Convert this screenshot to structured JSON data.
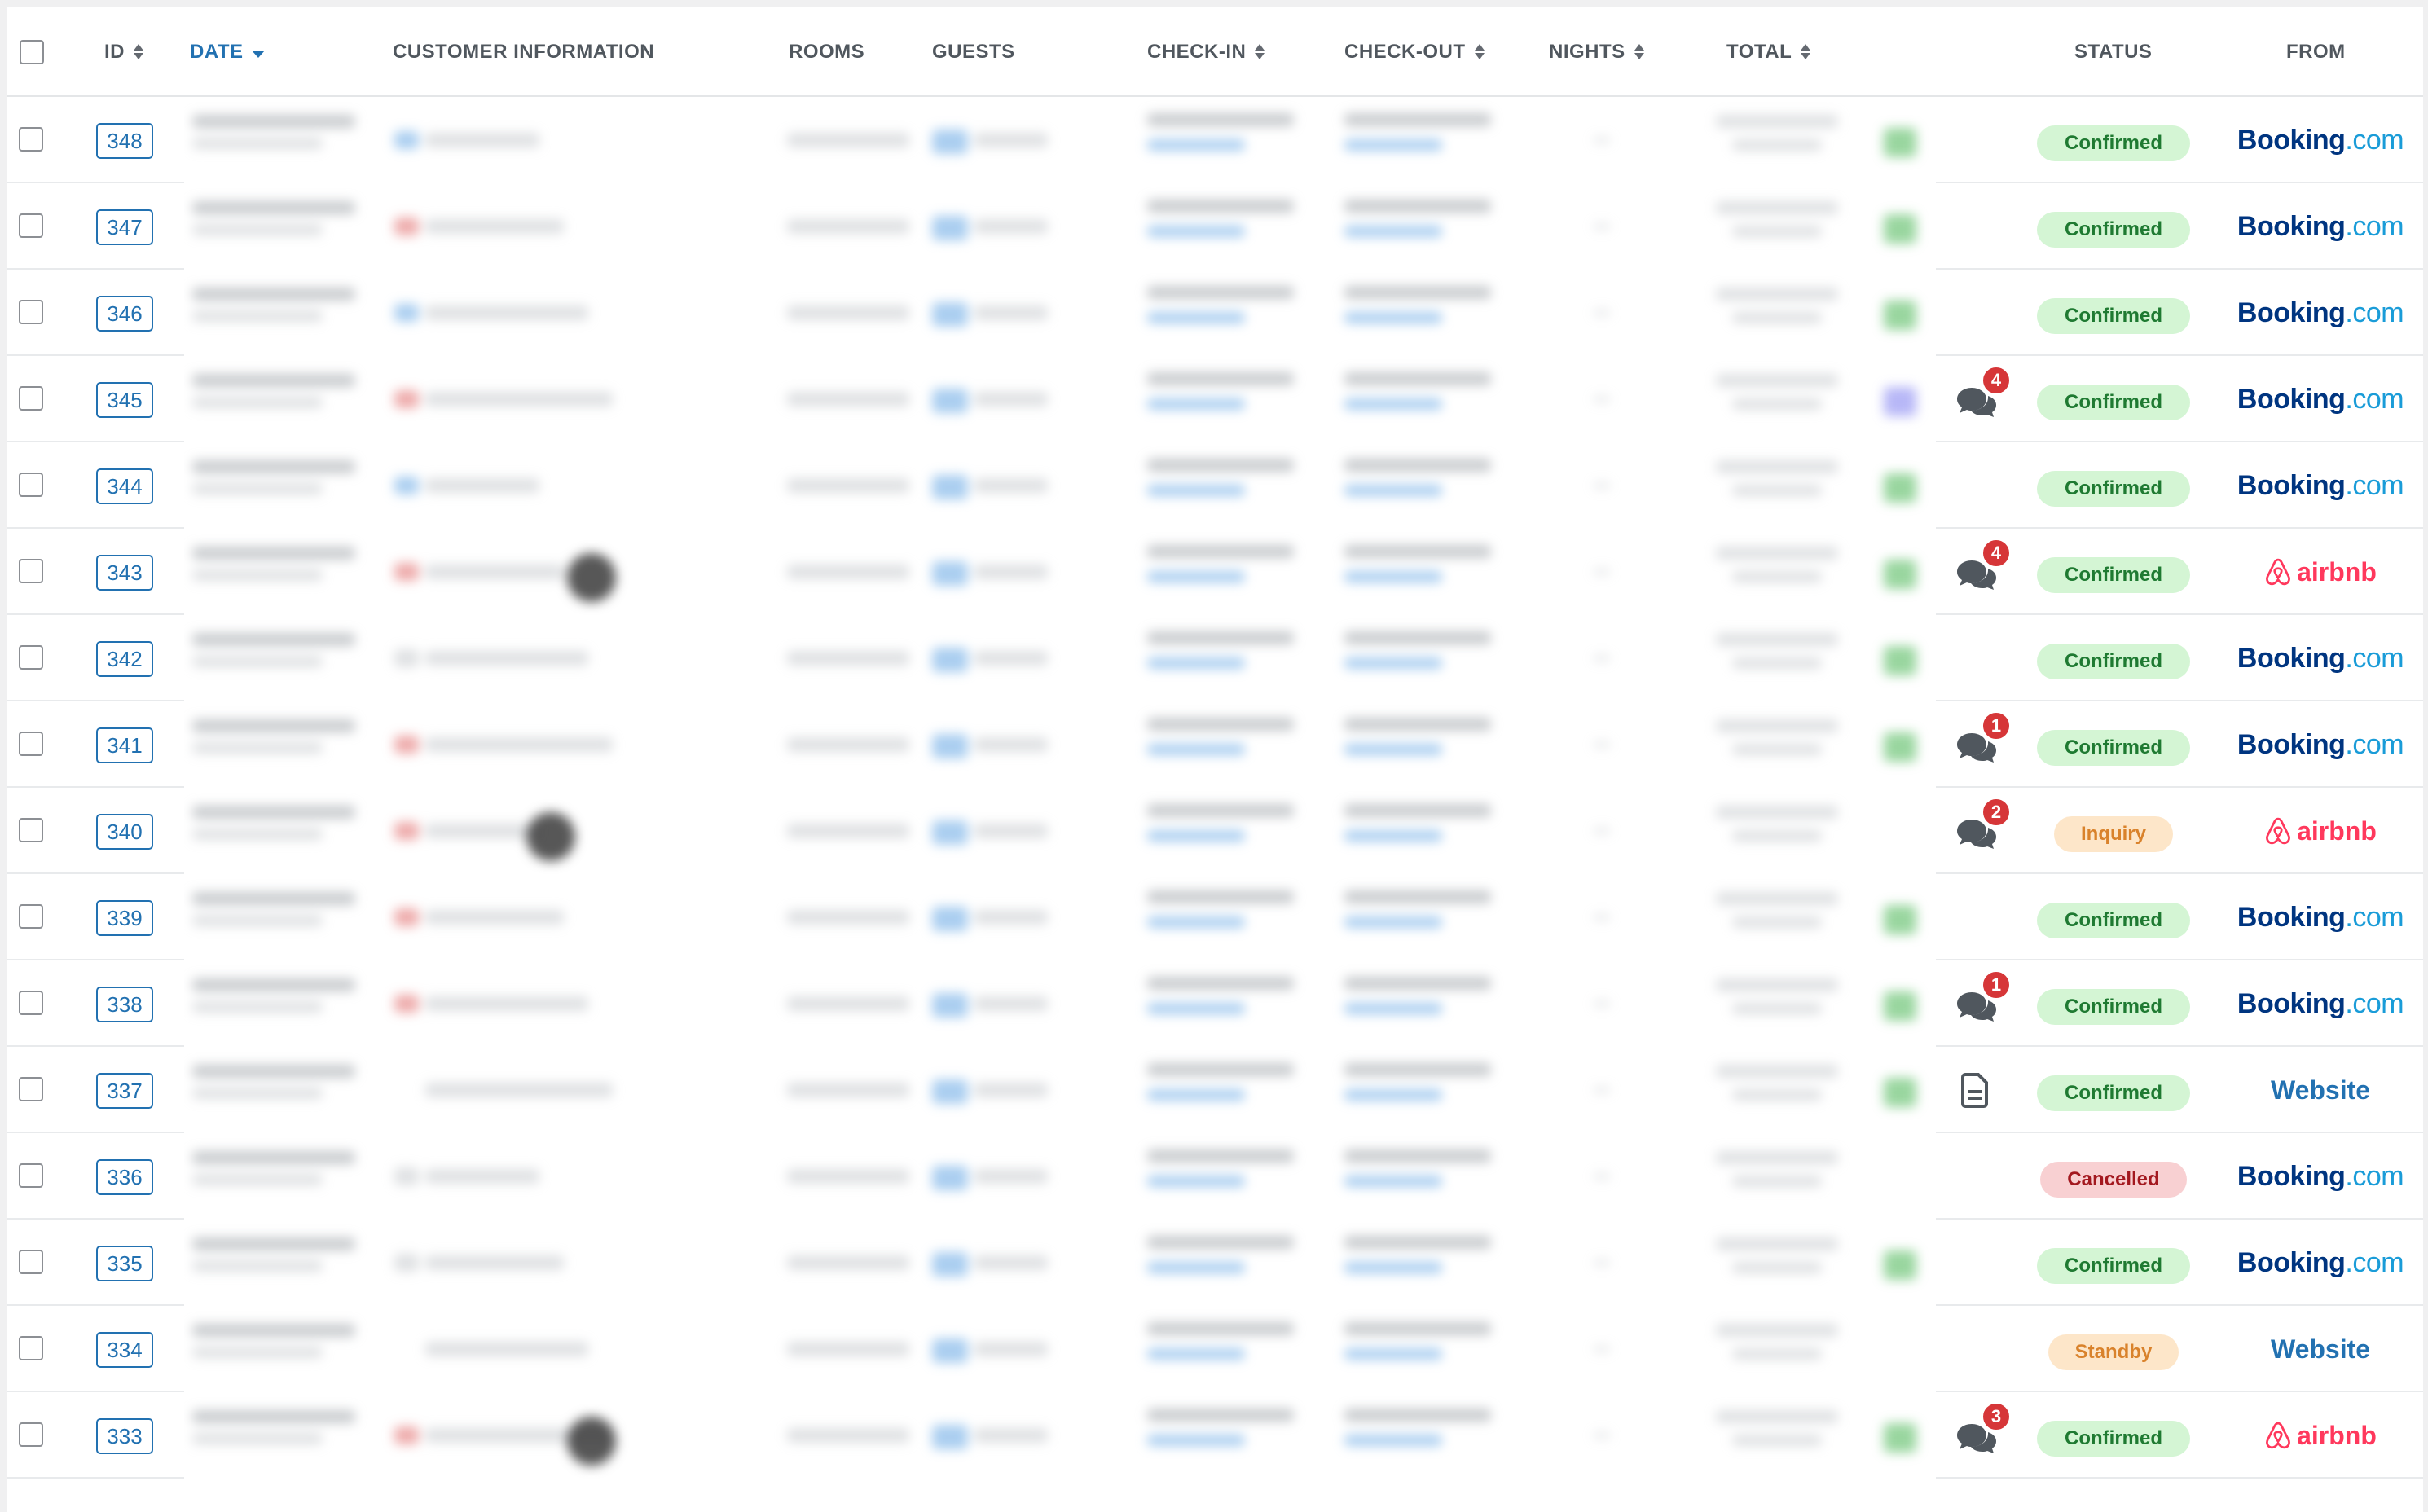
{
  "header": {
    "id": "ID",
    "date": "DATE",
    "customer": "CUSTOMER INFORMATION",
    "rooms": "ROOMS",
    "guests": "GUESTS",
    "checkin": "CHECK-IN",
    "checkout": "CHECK-OUT",
    "nights": "NIGHTS",
    "total": "TOTAL",
    "status": "STATUS",
    "from": "FROM"
  },
  "rows": [
    {
      "id": "348",
      "status": "Confirmed",
      "status_type": "confirmed",
      "source": "booking",
      "messages": null,
      "doc": false,
      "green": true,
      "avatar": false,
      "flag": "blue"
    },
    {
      "id": "347",
      "status": "Confirmed",
      "status_type": "confirmed",
      "source": "booking",
      "messages": null,
      "doc": false,
      "green": true,
      "avatar": false,
      "flag": "red"
    },
    {
      "id": "346",
      "status": "Confirmed",
      "status_type": "confirmed",
      "source": "booking",
      "messages": null,
      "doc": false,
      "green": true,
      "avatar": false,
      "flag": "blue"
    },
    {
      "id": "345",
      "status": "Confirmed",
      "status_type": "confirmed",
      "source": "booking",
      "messages": "4",
      "doc": false,
      "green": "purple",
      "avatar": false,
      "flag": "red"
    },
    {
      "id": "344",
      "status": "Confirmed",
      "status_type": "confirmed",
      "source": "booking",
      "messages": null,
      "doc": false,
      "green": true,
      "avatar": false,
      "flag": "blue"
    },
    {
      "id": "343",
      "status": "Confirmed",
      "status_type": "confirmed",
      "source": "airbnb",
      "messages": "4",
      "doc": false,
      "green": true,
      "avatar": true,
      "flag": "red"
    },
    {
      "id": "342",
      "status": "Confirmed",
      "status_type": "confirmed",
      "source": "booking",
      "messages": null,
      "doc": false,
      "green": true,
      "avatar": false,
      "flag": "light"
    },
    {
      "id": "341",
      "status": "Confirmed",
      "status_type": "confirmed",
      "source": "booking",
      "messages": "1",
      "doc": false,
      "green": true,
      "avatar": false,
      "flag": "red"
    },
    {
      "id": "340",
      "status": "Inquiry",
      "status_type": "inquiry",
      "source": "airbnb",
      "messages": "2",
      "doc": false,
      "green": false,
      "avatar": true,
      "flag": "red"
    },
    {
      "id": "339",
      "status": "Confirmed",
      "status_type": "confirmed",
      "source": "booking",
      "messages": null,
      "doc": false,
      "green": true,
      "avatar": false,
      "flag": "red"
    },
    {
      "id": "338",
      "status": "Confirmed",
      "status_type": "confirmed",
      "source": "booking",
      "messages": "1",
      "doc": false,
      "green": true,
      "avatar": false,
      "flag": "red"
    },
    {
      "id": "337",
      "status": "Confirmed",
      "status_type": "confirmed",
      "source": "website",
      "messages": null,
      "doc": true,
      "green": true,
      "avatar": false,
      "flag": "none"
    },
    {
      "id": "336",
      "status": "Cancelled",
      "status_type": "cancelled",
      "source": "booking",
      "messages": null,
      "doc": false,
      "green": false,
      "avatar": false,
      "flag": "light"
    },
    {
      "id": "335",
      "status": "Confirmed",
      "status_type": "confirmed",
      "source": "booking",
      "messages": null,
      "doc": false,
      "green": true,
      "avatar": false,
      "flag": "light"
    },
    {
      "id": "334",
      "status": "Standby",
      "status_type": "standby",
      "source": "website",
      "messages": null,
      "doc": false,
      "green": false,
      "avatar": false,
      "flag": "none"
    },
    {
      "id": "333",
      "status": "Confirmed",
      "status_type": "confirmed",
      "source": "airbnb",
      "messages": "3",
      "doc": false,
      "green": true,
      "avatar": true,
      "flag": "red"
    }
  ],
  "sources": {
    "booking_main": "Booking",
    "booking_suffix": ".com",
    "airbnb": "airbnb",
    "website": "Website"
  },
  "colors": {
    "accent": "#2271b1",
    "booking": "#003580",
    "airbnb": "#ff385c",
    "badge": "#d63638"
  }
}
